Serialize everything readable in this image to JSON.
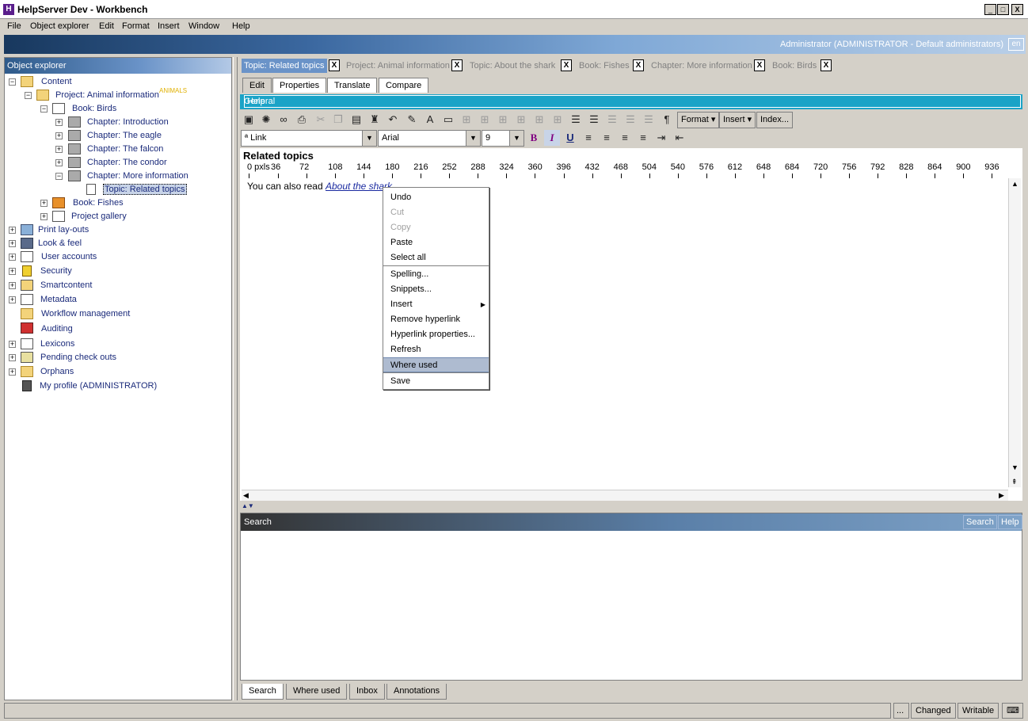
{
  "window": {
    "title": "HelpServer Dev - Workbench",
    "min": "_",
    "max": "□",
    "close": "X"
  },
  "menubar": [
    "File",
    "Object explorer",
    "Edit",
    "Format",
    "Insert",
    "Window",
    "Help"
  ],
  "banner": {
    "user": "Administrator (ADMINISTRATOR - Default administrators)",
    "lang": "en"
  },
  "object_explorer": {
    "title": "Object explorer",
    "project_tag": "ANIMALS",
    "tree": [
      "Content",
      "Project: Animal information",
      "Book: Birds",
      "Chapter: Introduction",
      "Chapter: The eagle",
      "Chapter: The falcon",
      "Chapter: The condor",
      "Chapter: More information",
      "Topic: Related topics",
      "Book: Fishes",
      "Project gallery",
      "Print lay-outs",
      "Look & feel",
      "User accounts",
      "Security",
      "Smartcontent",
      "Metadata",
      "Workflow management",
      "Auditing",
      "Lexicons",
      "Pending check outs",
      "Orphans",
      "My profile (ADMINISTRATOR)"
    ]
  },
  "doc_tabs": [
    "Topic: Related topics",
    "Project: Animal information",
    "Topic: About the shark",
    "Book: Fishes",
    "Chapter: More information",
    "Book: Birds"
  ],
  "doc_tab_close": "X",
  "sub_tabs": [
    "Edit",
    "Properties",
    "Translate",
    "Compare"
  ],
  "general_bar": {
    "title": "General",
    "help": "Help"
  },
  "toolbar": {
    "format": "Format",
    "insert": "Insert",
    "index": "Index...",
    "style": "Link",
    "font": "Arial",
    "size": "9",
    "bold": "B",
    "italic": "I",
    "underline": "U"
  },
  "editor": {
    "doc_title": "Related topics",
    "ruler": [
      "0 pxls",
      "36",
      "72",
      "108",
      "144",
      "180",
      "216",
      "252",
      "288",
      "324",
      "360",
      "396",
      "432",
      "468",
      "504",
      "540",
      "576",
      "612",
      "648",
      "684",
      "720",
      "756",
      "792",
      "828",
      "864",
      "900",
      "936"
    ],
    "text_before": "You can also read ",
    "link": "About the shark"
  },
  "context_menu": [
    "Undo",
    "Cut",
    "Copy",
    "Paste",
    "Select all",
    "Spelling...",
    "Snippets...",
    "Insert",
    "Remove hyperlink",
    "Hyperlink properties...",
    "Refresh",
    "Where used",
    "Save"
  ],
  "search_panel": {
    "title": "Search",
    "search_btn": "Search",
    "help_btn": "Help"
  },
  "bottom_tabs": [
    "Search",
    "Where used",
    "Inbox",
    "Annotations"
  ],
  "status": {
    "dots": "...",
    "changed": "Changed",
    "writable": "Writable"
  }
}
